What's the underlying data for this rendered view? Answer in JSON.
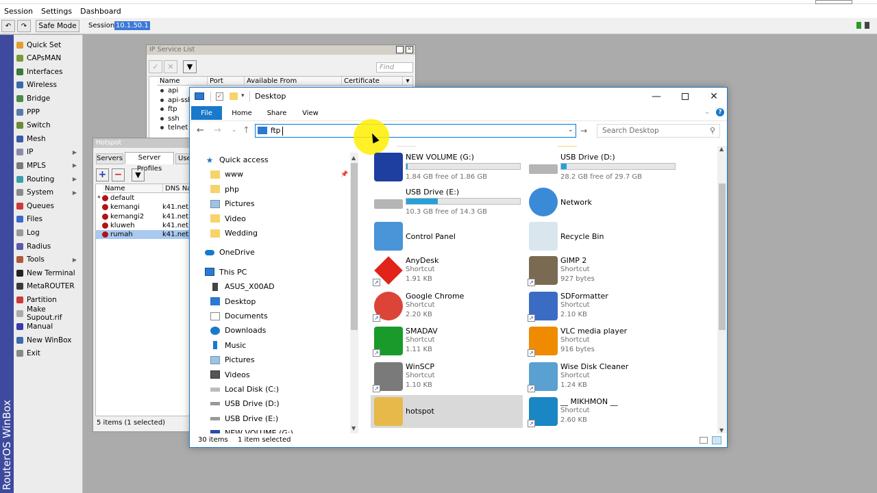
{
  "app": {
    "menu": [
      "Session",
      "Settings",
      "Dashboard"
    ],
    "toolbar": {
      "undo": "↶",
      "redo": "↷",
      "safe_mode": "Safe Mode",
      "session_label": "Session:",
      "session_value": "10.1.50.1"
    },
    "side_brand": "RouterOS WinBox"
  },
  "sidebar": {
    "items": [
      {
        "label": "Quick Set",
        "arrow": false,
        "color": "#e0a030"
      },
      {
        "label": "CAPsMAN",
        "arrow": false,
        "color": "#7a9a3a"
      },
      {
        "label": "Interfaces",
        "arrow": false,
        "color": "#3a7a3a"
      },
      {
        "label": "Wireless",
        "arrow": false,
        "color": "#3a6aaa"
      },
      {
        "label": "Bridge",
        "arrow": false,
        "color": "#4a8a4a"
      },
      {
        "label": "PPP",
        "arrow": false,
        "color": "#5a7aaa"
      },
      {
        "label": "Switch",
        "arrow": false,
        "color": "#6a8a3a"
      },
      {
        "label": "Mesh",
        "arrow": false,
        "color": "#3a5aaa"
      },
      {
        "label": "IP",
        "arrow": true,
        "color": "#8a8aaa"
      },
      {
        "label": "MPLS",
        "arrow": true,
        "color": "#7a7a7a"
      },
      {
        "label": "Routing",
        "arrow": true,
        "color": "#3aa0aa"
      },
      {
        "label": "System",
        "arrow": true,
        "color": "#8a8a8a"
      },
      {
        "label": "Queues",
        "arrow": false,
        "color": "#cc3a3a"
      },
      {
        "label": "Files",
        "arrow": false,
        "color": "#3a6acc"
      },
      {
        "label": "Log",
        "arrow": false,
        "color": "#9a9a9a"
      },
      {
        "label": "Radius",
        "arrow": false,
        "color": "#5a5aaa"
      },
      {
        "label": "Tools",
        "arrow": true,
        "color": "#aa5a3a"
      },
      {
        "label": "New Terminal",
        "arrow": false,
        "color": "#222222"
      },
      {
        "label": "MetaROUTER",
        "arrow": false,
        "color": "#3a3a3a"
      },
      {
        "label": "Partition",
        "arrow": false,
        "color": "#cc3a3a"
      },
      {
        "label": "Make Supout.rif",
        "arrow": false,
        "color": "#aaaaaa"
      },
      {
        "label": "Manual",
        "arrow": false,
        "color": "#3a3aaa"
      },
      {
        "label": "New WinBox",
        "arrow": false,
        "color": "#3a6aaa"
      },
      {
        "label": "Exit",
        "arrow": false,
        "color": "#888888"
      }
    ]
  },
  "ip_service": {
    "title": "IP Service List",
    "find_placeholder": "Find",
    "columns": [
      "Name",
      "Port",
      "Available From",
      "Certificate"
    ],
    "rows": [
      "api",
      "api-ssl",
      "ftp",
      "ssh",
      "telnet"
    ]
  },
  "hotspot": {
    "title": "Hotspot",
    "tabs": [
      "Servers",
      "Server Profiles",
      "Use"
    ],
    "columns": [
      "Name",
      "DNS Na"
    ],
    "rows": [
      {
        "name": "default",
        "dns": "",
        "star": "*",
        "selected": false
      },
      {
        "name": "kemangi",
        "dns": "k41.net",
        "star": "",
        "selected": false
      },
      {
        "name": "kemangi2",
        "dns": "k41.net",
        "star": "",
        "selected": false
      },
      {
        "name": "kluweh",
        "dns": "k41.net",
        "star": "",
        "selected": false
      },
      {
        "name": "rumah",
        "dns": "k41.net",
        "star": "",
        "selected": true
      }
    ],
    "status": "5 items (1 selected)"
  },
  "explorer": {
    "title": "Desktop",
    "ribbon_tabs": [
      "File",
      "Home",
      "Share",
      "View"
    ],
    "address_value": "ftp",
    "search_placeholder": "Search Desktop",
    "nav": {
      "quick_access": "Quick access",
      "quick_items": [
        "www",
        "php",
        "Pictures",
        "Video",
        "Wedding"
      ],
      "onedrive": "OneDrive",
      "this_pc": "This PC",
      "pc_items": [
        "ASUS_X00AD",
        "Desktop",
        "Documents",
        "Downloads",
        "Music",
        "Pictures",
        "Videos",
        "Local Disk (C:)",
        "USB Drive (D:)",
        "USB Drive (E:)",
        "NEW VOLUME (G:)"
      ]
    },
    "items": [
      {
        "name": "NEW VOLUME (G:)",
        "sub": "1.84 GB free of 1.86 GB",
        "fill": 0.01,
        "kind": "drive"
      },
      {
        "name": "USB Drive (D:)",
        "sub": "28.2 GB free of 29.7 GB",
        "fill": 0.05,
        "kind": "drive"
      },
      {
        "name": "USB Drive (E:)",
        "sub": "10.3 GB free of 14.3 GB",
        "fill": 0.28,
        "kind": "drive"
      },
      {
        "name": "Network",
        "sub": "",
        "kind": "plain"
      },
      {
        "name": "Control Panel",
        "sub": "",
        "kind": "plain"
      },
      {
        "name": "Recycle Bin",
        "sub": "",
        "kind": "plain"
      },
      {
        "name": "AnyDesk",
        "sub": "Shortcut",
        "size": "1.91 KB",
        "kind": "shortcut"
      },
      {
        "name": "GIMP 2",
        "sub": "Shortcut",
        "size": "927 bytes",
        "kind": "shortcut"
      },
      {
        "name": "Google Chrome",
        "sub": "Shortcut",
        "size": "2.20 KB",
        "kind": "shortcut"
      },
      {
        "name": "SDFormatter",
        "sub": "Shortcut",
        "size": "2.10 KB",
        "kind": "shortcut"
      },
      {
        "name": "SMADAV",
        "sub": "Shortcut",
        "size": "1.11 KB",
        "kind": "shortcut"
      },
      {
        "name": "VLC media player",
        "sub": "Shortcut",
        "size": "916 bytes",
        "kind": "shortcut"
      },
      {
        "name": "WinSCP",
        "sub": "Shortcut",
        "size": "1.10 KB",
        "kind": "shortcut"
      },
      {
        "name": "Wise Disk Cleaner",
        "sub": "Shortcut",
        "size": "1.24 KB",
        "kind": "shortcut"
      },
      {
        "name": "hotspot",
        "sub": "",
        "kind": "selected"
      },
      {
        "name": "__ MIKHMON __",
        "sub": "Shortcut",
        "size": "2.60 KB",
        "kind": "shortcut"
      }
    ],
    "status_count": "30 items",
    "status_selected": "1 item selected"
  },
  "colors": {
    "accent": "#0078d7",
    "cursor_highlight": "#ffee00"
  }
}
